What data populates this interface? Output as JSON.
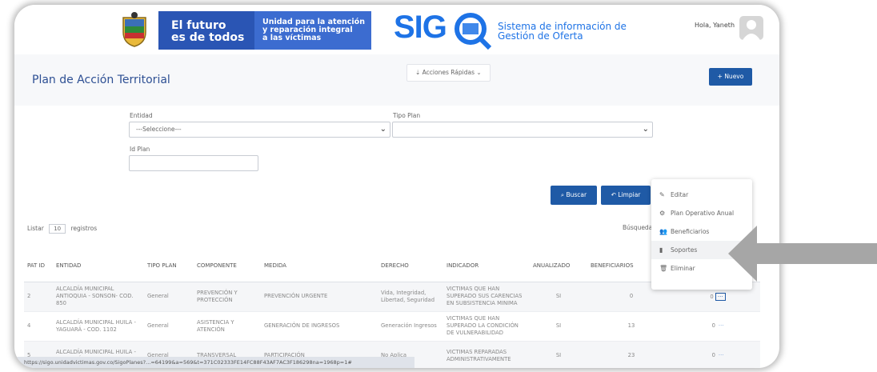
{
  "header": {
    "brand_line1": "El futuro",
    "brand_line2": "es de todos",
    "unidad_line1": "Unidad para la atención",
    "unidad_line2": "y reparación integral",
    "unidad_line3": "a las víctimas",
    "sigo_logo": "SIG",
    "sigo_subtitle_1": "Sistema de información de",
    "sigo_subtitle_2": "Gestión de Oferta",
    "greeting": "Hola, Yaneth"
  },
  "page": {
    "title": "Plan de Acción Territorial",
    "quick_actions": "⇣ Acciones Rápidas ⌄",
    "new_button": "+ Nuevo"
  },
  "filters": {
    "entidad_label": "Entidad",
    "entidad_value": "---Seleccione---",
    "tipo_plan_label": "Tipo Plan",
    "tipo_plan_value": "",
    "id_plan_label": "Id Plan",
    "id_plan_value": "",
    "search_button": "Buscar",
    "clear_button": "Limpiar"
  },
  "table_controls": {
    "listar_label": "Listar",
    "page_size": "10",
    "registros_label": "registros",
    "quick_search_label": "Búsqueda rápida"
  },
  "table": {
    "columns": [
      "PAT ID",
      "ENTIDAD",
      "TIPO PLAN",
      "COMPONENTE",
      "MEDIDA",
      "DERECHO",
      "INDICADOR",
      "ANUALIZADO",
      "BENEFICIARIOS",
      ""
    ],
    "rows": [
      {
        "id": "2",
        "entidad": "ALCALDÍA MUNICIPAL ANTIOQUIA - SONSON- COD. 850",
        "tipo": "General",
        "componente": "PREVENCIÓN Y PROTECCIÓN",
        "medida": "PREVENCIÓN URGENTE",
        "derecho": "Vida, Integridad, Libertad, Seguridad",
        "indicador": "VICTIMAS QUE HAN SUPERADO SUS CARENCIAS EN SUBSISTENCIA MINIMA",
        "anualizado": "SI",
        "beneficiarios": "0",
        "extra": "0"
      },
      {
        "id": "4",
        "entidad": "ALCALDÍA MUNICIPAL HUILA - YAGUARÁ - COD. 1102",
        "tipo": "General",
        "componente": "ASISTENCIA Y ATENCIÓN",
        "medida": "GENERACIÓN DE INGRESOS",
        "derecho": "Generación Ingresos",
        "indicador": "VICTIMAS QUE HAN SUPERADO LA CONDICIÓN DE VULNERABILIDAD",
        "anualizado": "SI",
        "beneficiarios": "13",
        "extra": "0"
      },
      {
        "id": "5",
        "entidad": "ALCALDÍA MUNICIPAL HUILA - YAGUARÁ - COD. 1102",
        "tipo": "General",
        "componente": "TRANSVERSAL",
        "medida": "PARTICIPACIÓN",
        "derecho": "No Aplica",
        "indicador": "VICTIMAS REPARADAS ADMINISTRATIVAMENTE",
        "anualizado": "SI",
        "beneficiarios": "23",
        "extra": "0"
      }
    ]
  },
  "context_menu": {
    "items": [
      "Editar",
      "Plan Operativo Anual",
      "Beneficiarios",
      "Soportes",
      "Eliminar"
    ]
  },
  "status_bar": {
    "url": "https://sigo.unidadvictimas.gov.co/SigoPlanes?...=64199&a=569&t=371C02333FE14FC88F43AF7AC3F186298na=1968p=1#"
  },
  "colors": {
    "brand_blue": "#1f5aa6",
    "title_blue": "#2d4f93",
    "sigo_blue": "#1e73e6",
    "arrow_gray": "#a6a6a6"
  }
}
